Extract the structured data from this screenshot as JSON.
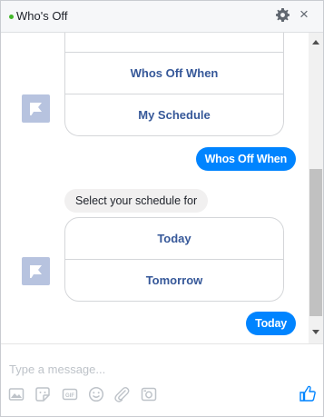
{
  "header": {
    "title": "Who's Off",
    "status_color": "#42b72a",
    "settings_icon": "gear-icon",
    "close_icon": "close-icon",
    "close_glyph": "×"
  },
  "conversation": {
    "card1": {
      "buttons": [
        "Whos Off When",
        "My Schedule"
      ]
    },
    "sent1": "Whos Off When",
    "received1": "Select your schedule for",
    "card2": {
      "buttons": [
        "Today",
        "Tomorrow"
      ]
    },
    "sent2": "Today"
  },
  "composer": {
    "placeholder": "Type a message...",
    "tools": [
      "image-icon",
      "sticker-icon",
      "gif-icon",
      "emoji-icon",
      "attachment-icon",
      "camera-icon"
    ],
    "like_icon": "thumbs-up-icon",
    "accent_color": "#0084ff"
  }
}
